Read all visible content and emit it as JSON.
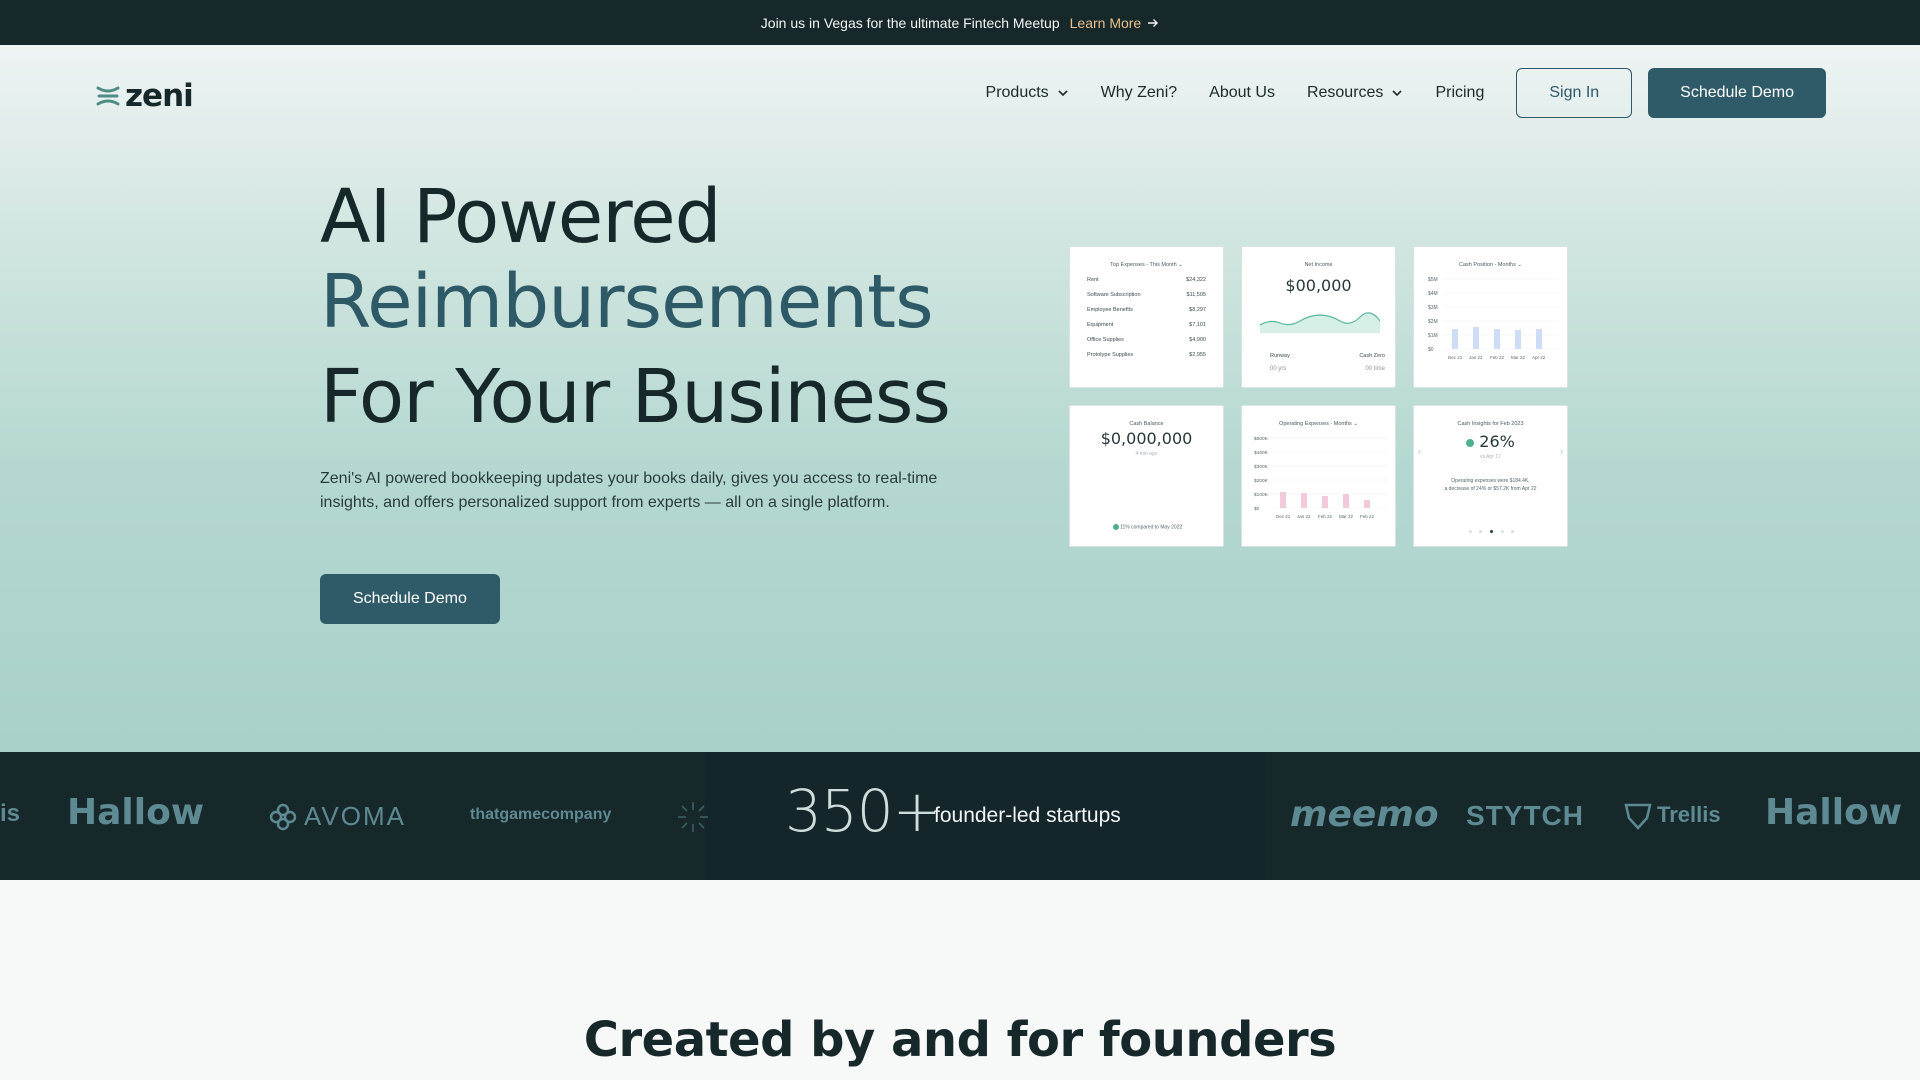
{
  "announcement": {
    "text": "Join us in Vegas for the ultimate Fintech Meetup",
    "link_label": "Learn More"
  },
  "brand": {
    "name": "zeni"
  },
  "nav": {
    "items": [
      {
        "label": "Products",
        "has_dropdown": true
      },
      {
        "label": "Why Zeni?",
        "has_dropdown": false
      },
      {
        "label": "About Us",
        "has_dropdown": false
      },
      {
        "label": "Resources",
        "has_dropdown": true
      },
      {
        "label": "Pricing",
        "has_dropdown": false
      }
    ],
    "sign_in": "Sign In",
    "schedule_demo": "Schedule Demo"
  },
  "hero": {
    "line1": "AI Powered",
    "line2": "Reimbursements",
    "line3": "For Your Business",
    "subtitle": "Zeni's AI powered bookkeeping updates your books daily, gives you access to real-time insights, and offers personalized support from experts — all on a single platform.",
    "cta": "Schedule Demo"
  },
  "dashboard": {
    "top_expenses": {
      "title": "Top Expenses - This Month ⌄",
      "rows": [
        {
          "label": "Rent",
          "value": "$24,322"
        },
        {
          "label": "Software Subscription",
          "value": "$11,505"
        },
        {
          "label": "Employee Benefits",
          "value": "$8,297"
        },
        {
          "label": "Equipment",
          "value": "$7,101"
        },
        {
          "label": "Office Supplies",
          "value": "$4,900"
        },
        {
          "label": "Prototype Supplies",
          "value": "$2,955"
        }
      ]
    },
    "net_income": {
      "title": "Net Income",
      "value": "$00,000",
      "runway_label": "Runway",
      "cash_zero_label": "Cash Zero",
      "runway_value": "00 yrs",
      "cash_zero_value": "00 time"
    },
    "cash_position": {
      "title": "Cash Position - Months ⌄",
      "y_ticks": [
        "$5M",
        "$4M",
        "$3M",
        "$2M",
        "$1M",
        "$0"
      ],
      "x_ticks": [
        "Dec 21",
        "Jan 22",
        "Feb 22",
        "Mar 22",
        "Apr 22"
      ]
    },
    "cash_balance": {
      "title": "Cash Balance",
      "value": "$0,000,000",
      "sub": "4 min ago",
      "compare": "11% compared to May 2022"
    },
    "operating_expenses": {
      "title": "Operating Expenses - Months ⌄",
      "y_ticks": [
        "$500K",
        "$400K",
        "$300K",
        "$200K",
        "$100K",
        "$0"
      ],
      "x_ticks": [
        "Dec 21",
        "Jan 22",
        "Feb 22",
        "Mar 22",
        "Feb 22"
      ]
    },
    "cash_insights": {
      "title": "Cash Insights for Feb 2023",
      "value": "26%",
      "sub": "vs Apr 17",
      "text1": "Operating expenses were $184.4K,",
      "text2": "a decrease of 24% or $57.2K from Apr 22"
    }
  },
  "logos": {
    "left": [
      "is",
      "Hallow",
      "AVOMA",
      "thatgamecompany"
    ],
    "right": [
      "meemo",
      "STYTCH",
      "Trellis",
      "Hallow"
    ]
  },
  "stat": {
    "number": "350+",
    "label": "founder-led startups"
  },
  "section": {
    "title": "Created by and for founders"
  },
  "colors": {
    "dark": "#17282a",
    "accent": "#2f5b69",
    "gold": "#e8c08a",
    "hero_teal": "#a9d0c9"
  }
}
